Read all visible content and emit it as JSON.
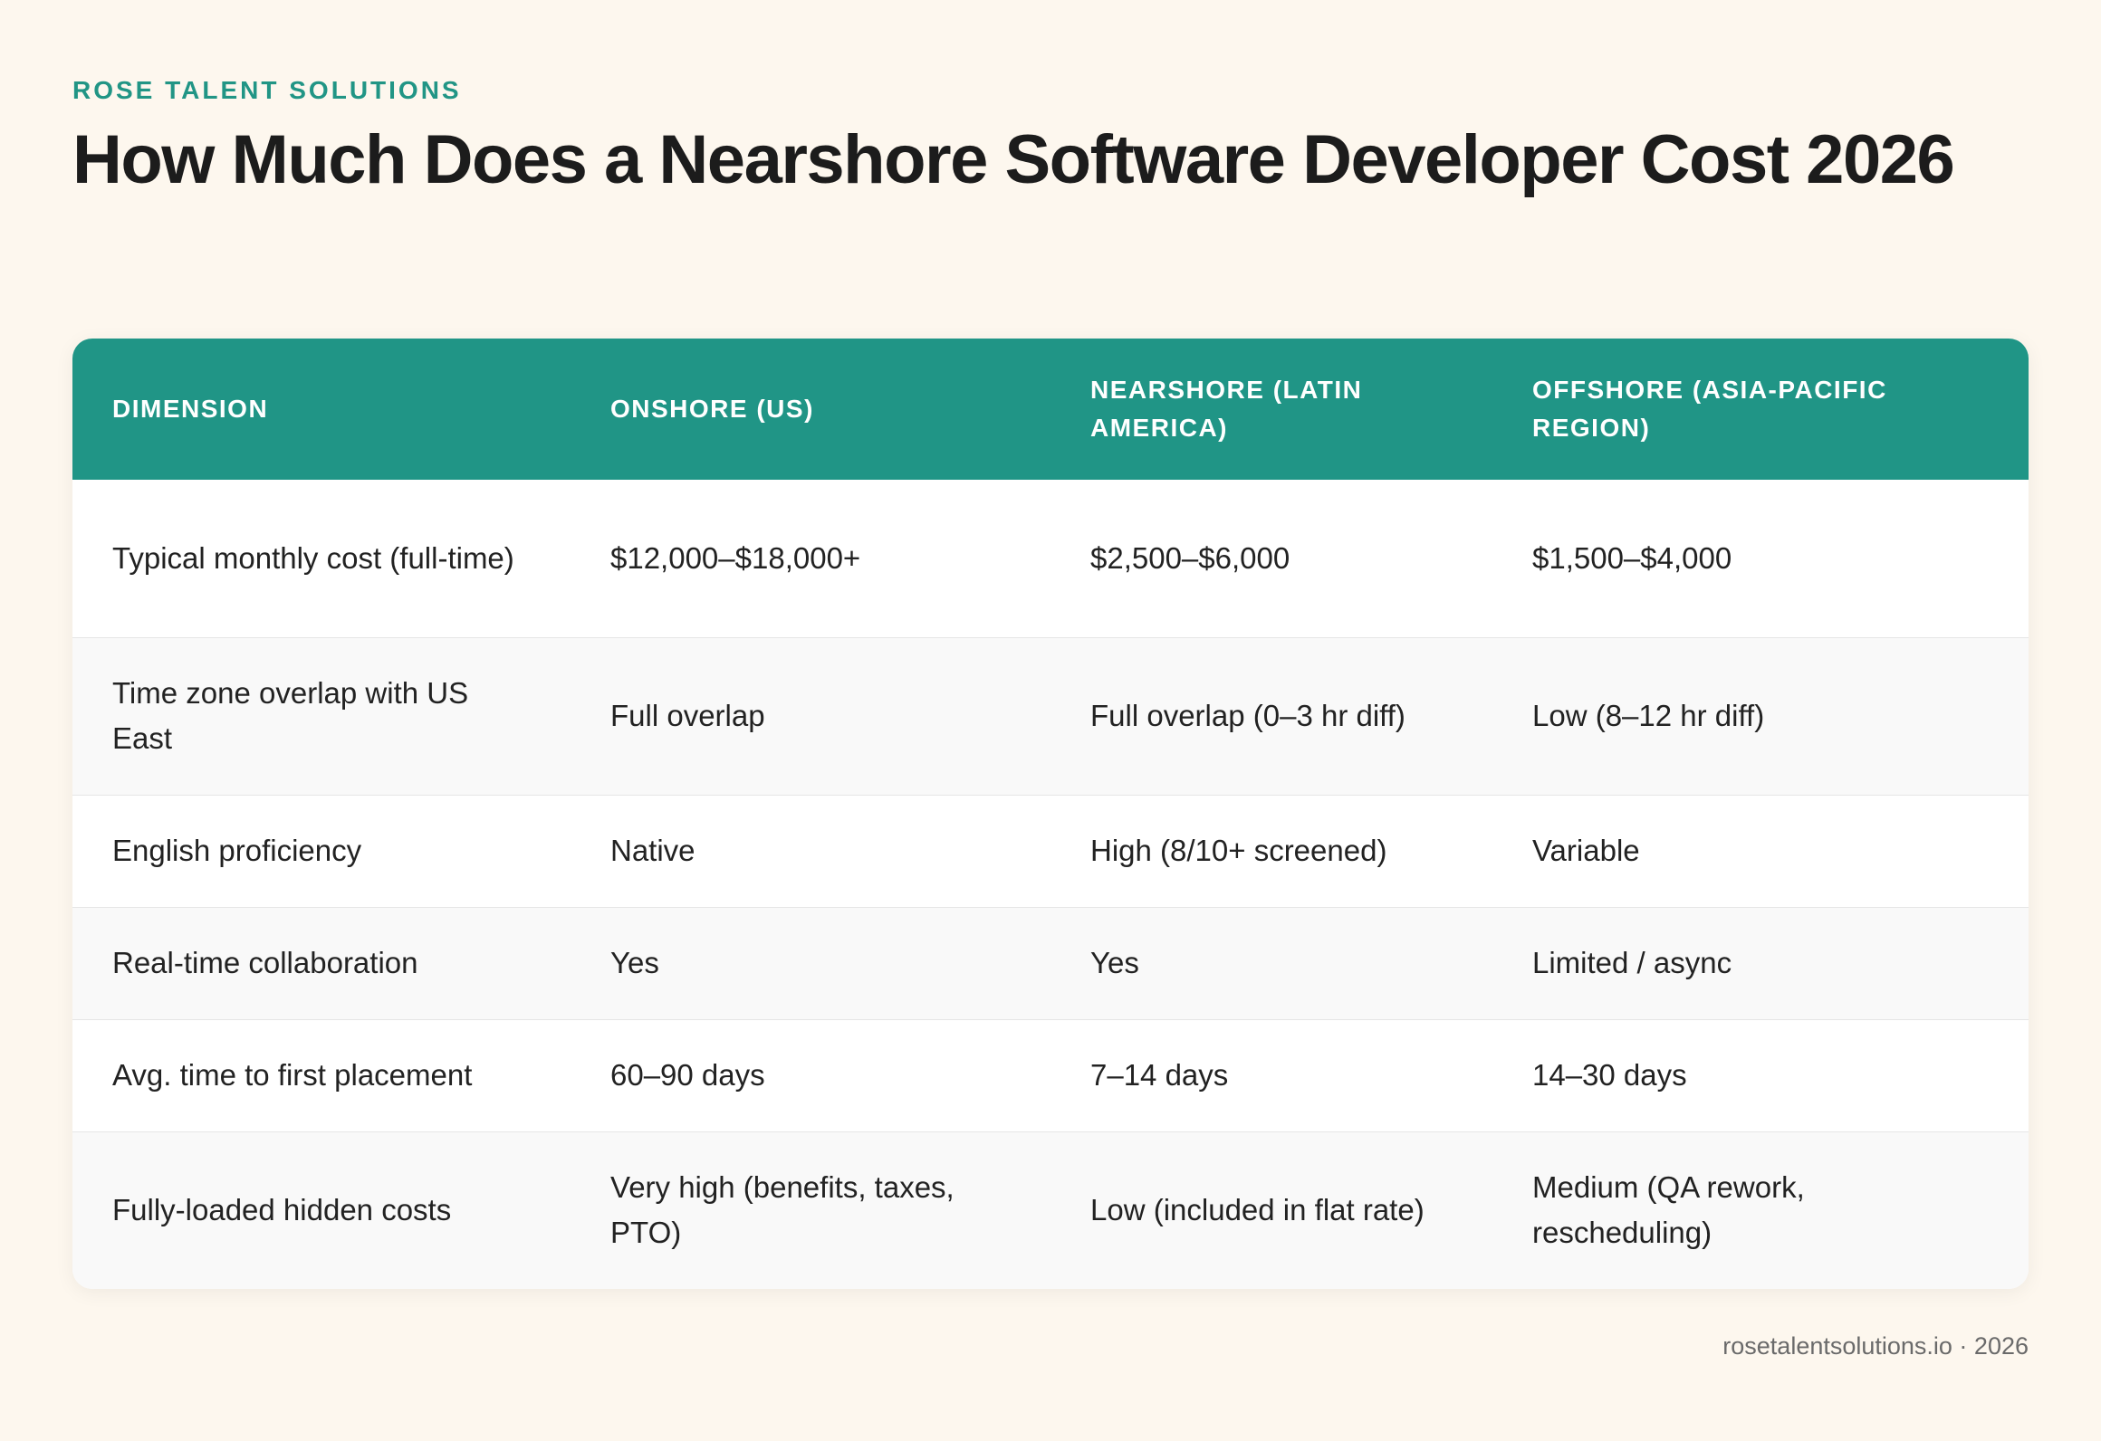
{
  "brand": "ROSE TALENT SOLUTIONS",
  "title": "How Much Does a Nearshore Software Developer Cost 2026",
  "table": {
    "headers": [
      "DIMENSION",
      "ONSHORE (US)",
      "NEARSHORE (LATIN AMERICA)",
      "OFFSHORE (ASIA-PACIFIC REGION)"
    ],
    "rows": [
      [
        "Typical monthly cost (full-time)",
        "$12,000–$18,000+",
        "$2,500–$6,000",
        "$1,500–$4,000"
      ],
      [
        "Time zone overlap with US East",
        "Full overlap",
        "Full overlap (0–3 hr diff)",
        "Low (8–12 hr diff)"
      ],
      [
        "English proficiency",
        "Native",
        "High (8/10+ screened)",
        "Variable"
      ],
      [
        "Real-time collaboration",
        "Yes",
        "Yes",
        "Limited / async"
      ],
      [
        "Avg. time to first placement",
        "60–90 days",
        "7–14 days",
        "14–30 days"
      ],
      [
        "Fully-loaded hidden costs",
        "Very high (benefits, taxes, PTO)",
        "Low (included in flat rate)",
        "Medium (QA rework, rescheduling)"
      ]
    ]
  },
  "footer": "rosetalentsolutions.io · 2026",
  "colors": {
    "background": "#fdf7ee",
    "accent": "#209586",
    "text": "#1c1c1c"
  }
}
